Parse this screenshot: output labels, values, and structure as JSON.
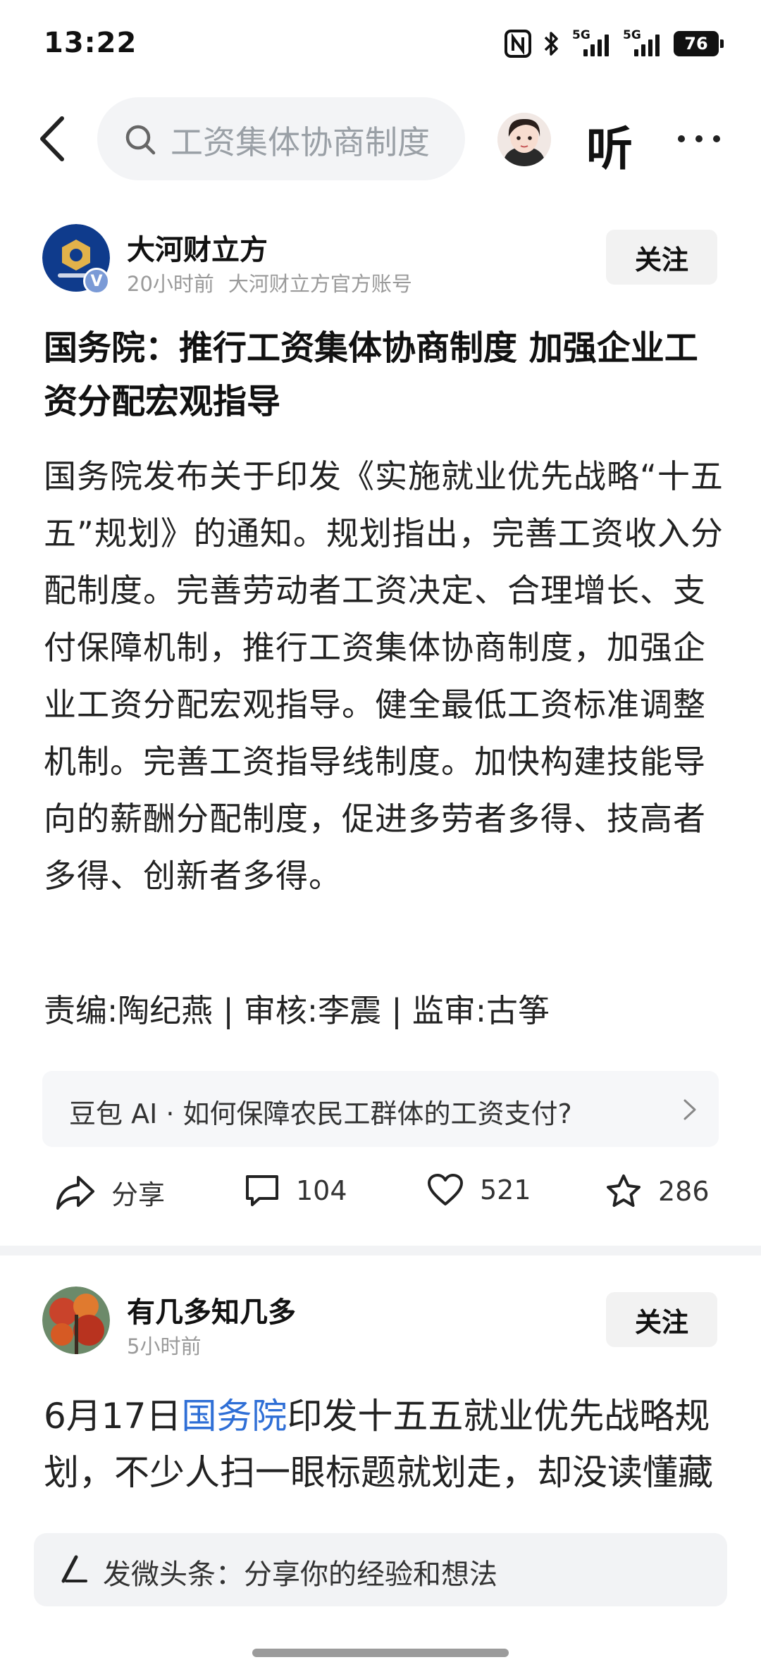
{
  "status": {
    "time": "13:22",
    "network1": "5G",
    "network2": "5G",
    "battery": "76"
  },
  "search": {
    "query": "工资集体协商制度"
  },
  "header": {
    "listen_label": "听"
  },
  "post1": {
    "author": "大河财立方",
    "time": "20小时前",
    "account_desc": "大河财立方官方账号",
    "verified": "V",
    "follow": "关注",
    "title": "国务院：推行工资集体协商制度 加强企业工资分配宏观指导",
    "body": "国务院发布关于印发《实施就业优先战略“十五五”规划》的通知。规划指出，完善工资收入分配制度。完善劳动者工资决定、合理增长、支付保障机制，推行工资集体协商制度，加强企业工资分配宏观指导。健全最低工资标准调整机制。完善工资指导线制度。加快构建技能导向的薪酬分配制度，促进多劳者多得、技高者多得、创新者多得。",
    "editors": "责编:陶纪燕 | 审核:李震 | 监审:古筝",
    "ai_prompt": "豆包 AI · 如何保障农民工群体的工资支付?",
    "actions": {
      "share": "分享",
      "comments": "104",
      "likes": "521",
      "favorites": "286"
    }
  },
  "post2": {
    "author": "有几多知几多",
    "time": "5小时前",
    "follow": "关注",
    "body_prefix": "6月17日",
    "body_link": "国务院",
    "body_rest": "印发十五五就业优先战略规划，不少人扫一眼标题就划走，却没读懂藏在文件里关乎普通人饭碗的关键信号"
  },
  "composer": {
    "placeholder": "发微头条：分享你的经验和想法"
  },
  "colors": {
    "link": "#2f6fd6",
    "verified_badge": "#7a9ad6",
    "button_bg": "#f2f2f2"
  },
  "icons": [
    "back-arrow-icon",
    "search-icon",
    "more-icon",
    "share-icon",
    "comment-icon",
    "heart-icon",
    "star-icon",
    "chevron-right-icon",
    "pen-icon"
  ]
}
